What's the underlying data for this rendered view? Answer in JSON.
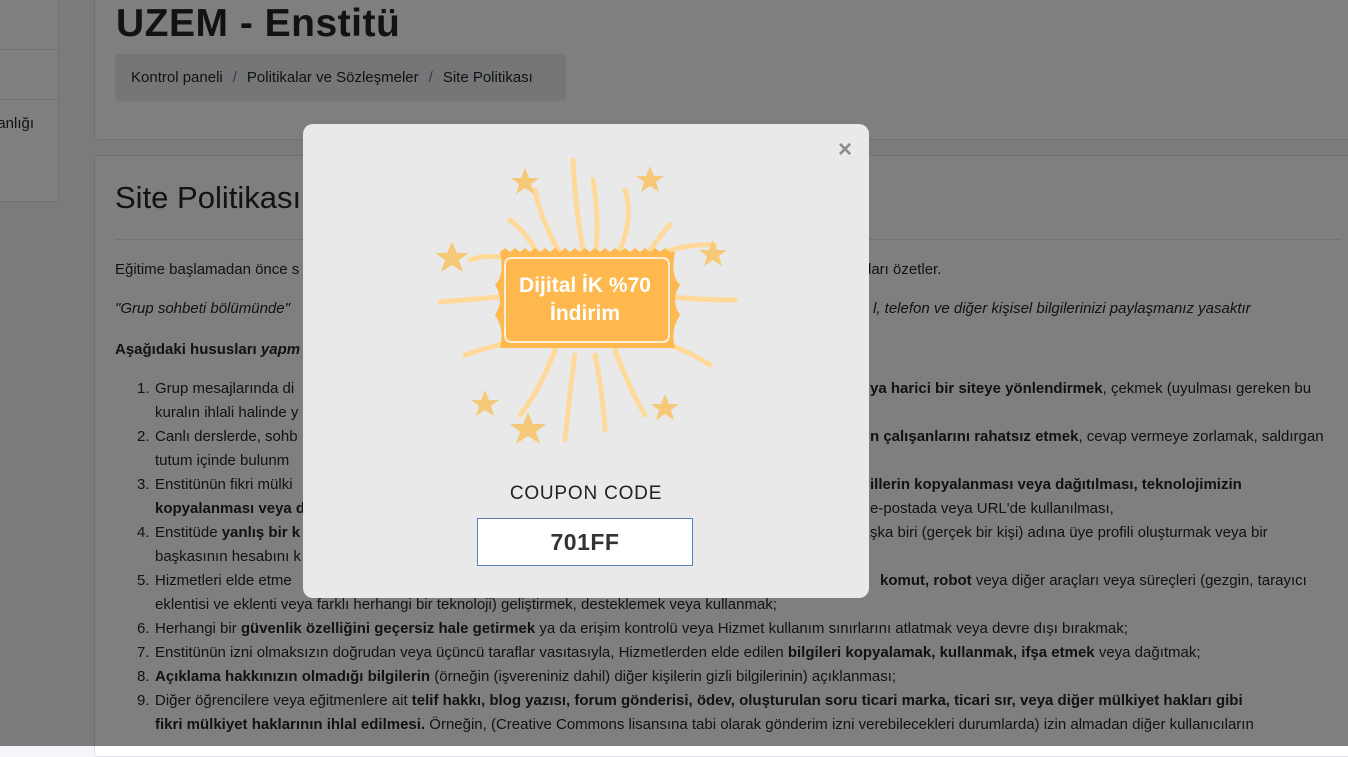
{
  "sidebar": {
    "items": [
      {
        "label": ""
      },
      {
        "label": ""
      },
      {
        "label": "anlığı"
      }
    ]
  },
  "header": {
    "title": "UZEM - Enstitü",
    "breadcrumb": [
      "Kontrol paneli",
      "Politikalar ve Sözleşmeler",
      "Site Politikası"
    ]
  },
  "main": {
    "section_title": "Site Politikası",
    "intro": "Eğitime başlamadan önce s",
    "intro_tail": "uralları özetler.",
    "warning": "\"Grup sohbeti bölümünde\"",
    "warning_tail": "l, telefon ve diğer kişisel bilgilerinizi paylaşmanız yasaktır",
    "rules_heading": "Aşağıdaki hususları ",
    "rules_heading_em": "yapm",
    "rules": [
      {
        "num": "1.",
        "l1a": "Grup mesajlarında di",
        "l1b_bold": "ya harici bir siteye yönlendirmek",
        "l1c": ", çekmek (uyulması gereken bu",
        "l2": "kuralın ihlali halinde y"
      },
      {
        "num": "2.",
        "l1a": "Canlı derslerde, sohb",
        "l1b_bold": "n çalışanlarını rahatsız etmek",
        "l1c": ", cevap vermeye zorlamak, saldırgan",
        "l2": "tutum içinde bulunm"
      },
      {
        "num": "3.",
        "l1a": "Enstitünün fikri mülki",
        "l1b_bold": "illerin kopyalanması veya dağıtılması, teknolojimizin",
        "l1c": "",
        "l2_bold": "kopyalanması veya d",
        "l2_tail": "e-postada veya URL'de kullanılması,"
      },
      {
        "num": "4.",
        "l1a": "Enstitüde ",
        "l1a_bold": "yanlış bir k",
        "l1c": "şka biri (gerçek bir kişi) adına üye profili oluşturmak veya bir",
        "l2": "başkasının hesabını k"
      },
      {
        "num": "5.",
        "l1a": "Hizmetleri elde etme",
        "l1b_bold": "komut, robot",
        "l1c": " veya diğer araçları veya süreçleri (gezgin, tarayıcı",
        "l2": "eklentisi ve eklenti veya farklı herhangi bir teknoloji) geliştirmek, desteklemek veya kullanmak;"
      },
      {
        "num": "6.",
        "a": "Herhangi bir ",
        "b": "güvenlik özelliğini geçersiz hale getirmek",
        "c": " ya da erişim kontrolü veya Hizmet kullanım sınırlarını atlatmak veya devre dışı bırakmak;"
      },
      {
        "num": "7.",
        "a": "Enstitünün izni olmaksızın doğrudan veya üçüncü taraflar vasıtasıyla, Hizmetlerden elde edilen ",
        "b": "bilgileri kopyalamak, kullanmak, ifşa etmek",
        "c": " veya dağıtmak;"
      },
      {
        "num": "8.",
        "a": "",
        "b": "Açıklama hakkınızın olmadığı bilgilerin",
        "c": " (örneğin (işvereniniz dahil) diğer kişilerin gizli bilgilerinin) açıklanması;"
      },
      {
        "num": "9.",
        "a": "Diğer öğrencilere veya eğitmenlere ait ",
        "b": "telif hakkı, blog yazısı, forum gönderisi, ödev, oluşturulan soru ticari marka, ticari sır, veya diğer mülkiyet hakları gibi",
        "l2b": "fikri mülkiyet haklarının ihlal edilmesi.",
        "l2c": " Örneğin, (Creative Commons lisansına tabi olarak gönderim izni verebilecekleri durumlarda) izin almadan diğer kullanıcıların"
      }
    ]
  },
  "modal": {
    "badge_line1": "Dijital İK %70",
    "badge_line2": "İndirim",
    "coupon_label": "COUPON CODE",
    "coupon_code": "701FF",
    "close_icon": "×",
    "colors": {
      "badge": "#ffb84d",
      "rays": "#ffd99a",
      "stars": "#f5c977",
      "backdrop": "#e9e9e9"
    }
  }
}
